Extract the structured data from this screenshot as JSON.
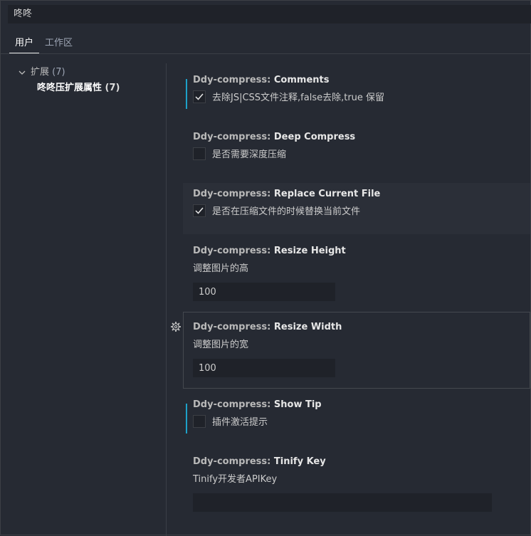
{
  "search": {
    "value": "咚咚"
  },
  "tabs": [
    {
      "label": "用户",
      "active": true
    },
    {
      "label": "工作区",
      "active": false
    }
  ],
  "tree": {
    "group_label": "扩展",
    "group_count": "(7)",
    "leaf_label": "咚咚压扩展属性",
    "leaf_count": "(7)"
  },
  "settings": [
    {
      "category": "Ddy-compress: ",
      "name": "Comments",
      "type": "checkbox",
      "checked": true,
      "description": "去除JS|CSS文件注释,false去除,true 保留"
    },
    {
      "category": "Ddy-compress: ",
      "name": "Deep Compress",
      "type": "checkbox",
      "checked": false,
      "description": "是否需要深度压缩"
    },
    {
      "category": "Ddy-compress: ",
      "name": "Replace Current File",
      "type": "checkbox",
      "checked": true,
      "description": "是否在压缩文件的时候替换当前文件"
    },
    {
      "category": "Ddy-compress: ",
      "name": "Resize Height",
      "type": "number",
      "description": "调整图片的高",
      "value": "100"
    },
    {
      "category": "Ddy-compress: ",
      "name": "Resize Width",
      "type": "number",
      "description": "调整图片的宽",
      "value": "100"
    },
    {
      "category": "Ddy-compress: ",
      "name": "Show Tip",
      "type": "checkbox",
      "checked": false,
      "description": "插件激活提示"
    },
    {
      "category": "Ddy-compress: ",
      "name": "Tinify Key",
      "type": "text",
      "description": "Tinify开发者APIKey",
      "value": ""
    }
  ],
  "colors": {
    "background": "#262a33",
    "modified_indicator": "#1ea1c9",
    "input_bg": "#1f2229"
  }
}
